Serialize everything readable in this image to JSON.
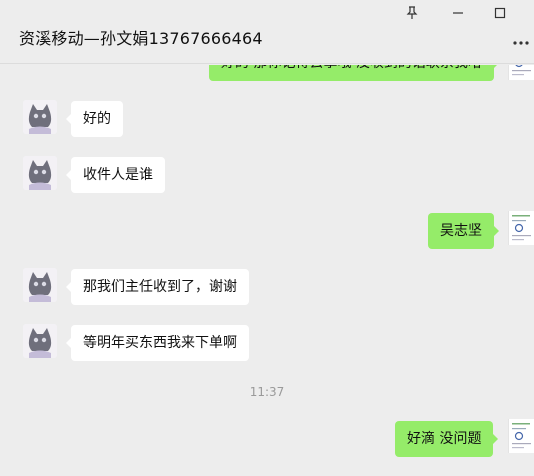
{
  "window": {
    "title": "资溪移动—孙文娟13767666464",
    "pin_icon": "pin-icon",
    "minimize_icon": "minimize-icon",
    "maximize_icon": "maximize-icon",
    "more_icon": "more-dots-icon"
  },
  "messages": [
    {
      "side": "right",
      "text": "好的 那你记得去拿哦 没收到的话联系我哈"
    },
    {
      "side": "left",
      "text": "好的"
    },
    {
      "side": "left",
      "text": "收件人是谁"
    },
    {
      "side": "right",
      "text": "吴志坚"
    },
    {
      "side": "left",
      "text": "那我们主任收到了，谢谢"
    },
    {
      "side": "left",
      "text": "等明年买东西我来下单啊"
    },
    {
      "side": "right",
      "text": "好滴 没问题"
    }
  ],
  "timestamp": "11:37",
  "colors": {
    "own_bubble": "#95ec69",
    "other_bubble": "#ffffff",
    "background": "#ededed"
  }
}
